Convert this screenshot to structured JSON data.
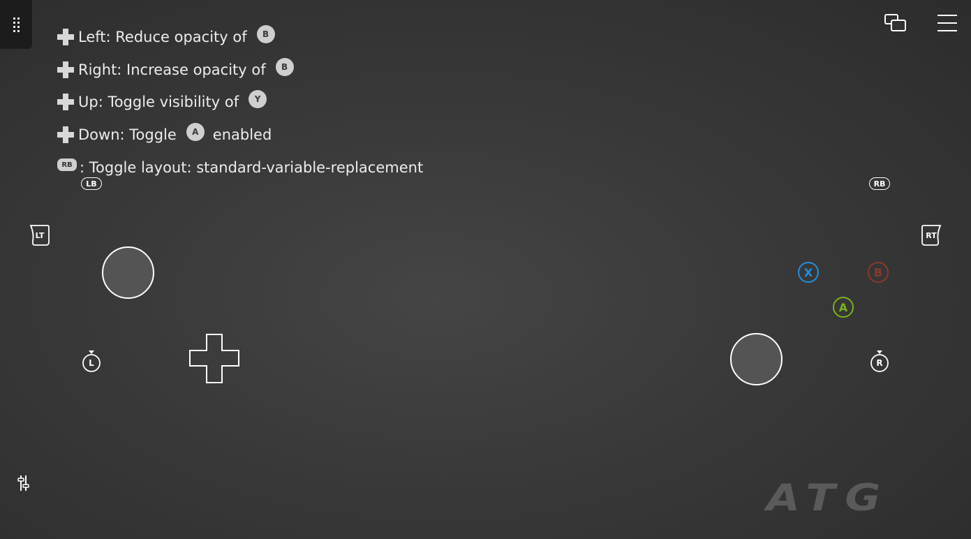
{
  "hints": [
    {
      "prefix": "Left: Reduce opacity of",
      "button": "B"
    },
    {
      "prefix": "Right: Increase opacity of",
      "button": "B"
    },
    {
      "prefix": "Up: Toggle visibility of",
      "button": "Y"
    },
    {
      "prefix": "Down: Toggle",
      "button": "A",
      "suffix": "enabled"
    }
  ],
  "layout_hint": {
    "button": "RB",
    "text": ": Toggle layout: standard-variable-replacement"
  },
  "controls": {
    "lb": "LB",
    "rb": "RB",
    "lt": "LT",
    "rt": "RT",
    "l": "L",
    "r": "R",
    "x": "X",
    "b": "B",
    "a": "A"
  },
  "colors": {
    "x": "#1e90e0",
    "b": "#8a3a2a",
    "a": "#7ab317"
  },
  "logo": "ATG",
  "icons": {
    "grip": "drag-handle-icon",
    "window": "window-switch-icon",
    "menu": "hamburger-menu-icon",
    "tools": "settings-sliders-icon"
  }
}
